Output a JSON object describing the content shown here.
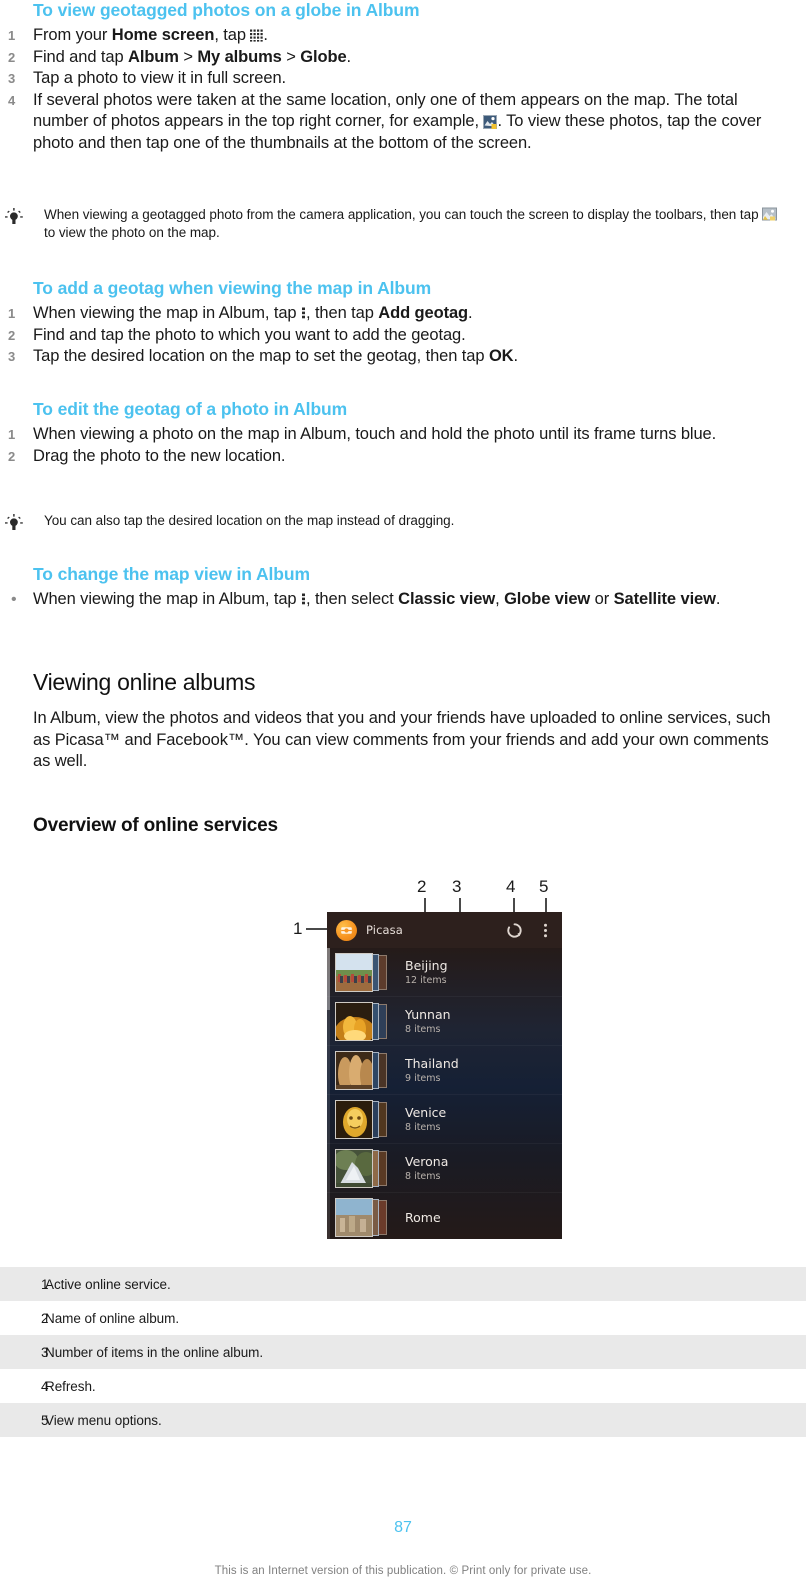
{
  "colors": {
    "heading_blue": "#4cc2ef",
    "legend_stripe": "#e9e9e9",
    "footer_gray": "#808080"
  },
  "sections": [
    {
      "heading": "To view geotagged photos on a globe in Album",
      "list_type": "ordered",
      "steps": [
        "From your Home screen, tap .",
        "Find and tap Album > My albums > Globe.",
        "Tap a photo to view it in full screen.",
        "If several photos were taken at the same location, only one of them appears on the map. The total number of photos appears in the top right corner, for example, . To view these photos, tap the cover photo and then tap one of the thumbnails at the bottom of the screen."
      ]
    },
    {
      "heading": "To add a geotag when viewing the map in Album",
      "list_type": "ordered",
      "steps": [
        "When viewing the map in Album, tap , then tap Add geotag.",
        "Find and tap the photo to which you want to add the geotag.",
        "Tap the desired location on the map to set the geotag, then tap OK."
      ]
    },
    {
      "heading": "To edit the geotag of a photo in Album",
      "list_type": "ordered",
      "steps": [
        "When viewing a photo on the map in Album, touch and hold the photo until its frame turns blue.",
        "Drag the photo to the new location."
      ]
    },
    {
      "heading": "To change the map view in Album",
      "list_type": "bullet",
      "steps": [
        "When viewing the map in Album, tap , then select Classic view, Globe view or Satellite view."
      ]
    }
  ],
  "step_fragments": {
    "s1_1_a": "From your ",
    "s1_1_b": "Home screen",
    "s1_1_c": ", tap ",
    "s1_1_d": ".",
    "s1_2_a": "Find and tap ",
    "s1_2_b": "Album",
    "s1_2_c": " > ",
    "s1_2_d": "My albums",
    "s1_2_e": " > ",
    "s1_2_f": "Globe",
    "s1_2_g": ".",
    "s1_3": "Tap a photo to view it in full screen.",
    "s1_4_a": "If several photos were taken at the same location, only one of them appears on the map. The total number of photos appears in the top right corner, for example, ",
    "s1_4_b": ". To view these photos, tap the cover photo and then tap one of the thumbnails at the bottom of the screen.",
    "s2_1_a": "When viewing the map in Album, tap ",
    "s2_1_b": ", then tap ",
    "s2_1_c": "Add geotag",
    "s2_1_d": ".",
    "s2_2": "Find and tap the photo to which you want to add the geotag.",
    "s2_3_a": "Tap the desired location on the map to set the geotag, then tap ",
    "s2_3_b": "OK",
    "s2_3_c": ".",
    "s3_1": "When viewing a photo on the map in Album, touch and hold the photo until its frame turns blue.",
    "s3_2": "Drag the photo to the new location.",
    "s4_1_a": "When viewing the map in Album, tap ",
    "s4_1_b": ", then select ",
    "s4_1_c": "Classic view",
    "s4_1_d": ", ",
    "s4_1_e": "Globe view",
    "s4_1_f": " or ",
    "s4_1_g": "Satellite view",
    "s4_1_h": "."
  },
  "tips": {
    "tip1_a": "When viewing a geotagged photo from the camera application, you can touch the screen to display the toolbars, then tap ",
    "tip1_b": " to view the photo on the map.",
    "tip2": "You can also tap the desired location on the map instead of dragging."
  },
  "section_viewing_online": {
    "heading": "Viewing online albums",
    "paragraph": "In Album, view the photos and videos that you and your friends have uploaded to online services, such as Picasa™ and Facebook™. You can view comments from your friends and add your own comments as well."
  },
  "section_overview": {
    "heading": "Overview of online services"
  },
  "figure": {
    "callouts": [
      {
        "id": "1",
        "label": "1"
      },
      {
        "id": "2",
        "label": "2"
      },
      {
        "id": "3",
        "label": "3"
      },
      {
        "id": "4",
        "label": "4"
      },
      {
        "id": "5",
        "label": "5"
      }
    ],
    "screenshot": {
      "service_name": "Picasa",
      "service_icon": "picasa-icon",
      "refresh_icon": "refresh-icon",
      "menu_icon": "kebab-menu-icon",
      "albums": [
        {
          "name": "Beijing",
          "count": "12 items"
        },
        {
          "name": "Yunnan",
          "count": "8 items"
        },
        {
          "name": "Thailand",
          "count": "9 items"
        },
        {
          "name": "Venice",
          "count": "8 items"
        },
        {
          "name": "Verona",
          "count": "8 items"
        },
        {
          "name": "Rome",
          "count": ""
        }
      ]
    }
  },
  "legend": {
    "rows": [
      {
        "num": "1",
        "text": "Active online service."
      },
      {
        "num": "2",
        "text": "Name of online album."
      },
      {
        "num": "3",
        "text": "Number of items in the online album."
      },
      {
        "num": "4",
        "text": "Refresh."
      },
      {
        "num": "5",
        "text": "View menu options."
      }
    ]
  },
  "footer": {
    "page_number": "87",
    "note": "This is an Internet version of this publication. © Print only for private use."
  }
}
